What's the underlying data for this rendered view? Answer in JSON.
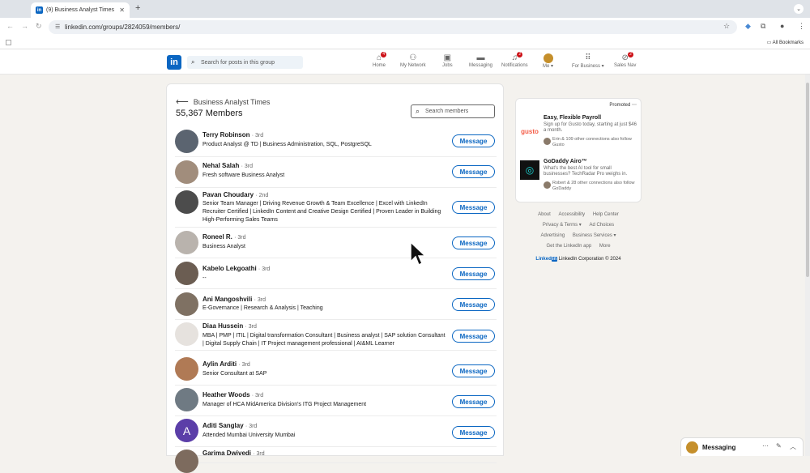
{
  "browser": {
    "tab_title": "(9) Business Analyst Times",
    "url": "linkedin.com/groups/2824059/members/",
    "all_bookmarks": "All Bookmarks"
  },
  "header": {
    "search_placeholder": "Search for posts in this group",
    "nav": [
      {
        "label": "Home",
        "icon": "home-icon",
        "badge": "4"
      },
      {
        "label": "My Network",
        "icon": "network-icon",
        "badge": ""
      },
      {
        "label": "Jobs",
        "icon": "briefcase-icon",
        "badge": ""
      },
      {
        "label": "Messaging",
        "icon": "chat-icon",
        "badge": ""
      },
      {
        "label": "Notifications",
        "icon": "bell-icon",
        "badge": "2"
      },
      {
        "label": "Me ▾",
        "icon": "avatar-icon",
        "badge": ""
      },
      {
        "label": "For Business ▾",
        "icon": "grid-icon",
        "badge": ""
      },
      {
        "label": "Sales Nav",
        "icon": "compass-icon",
        "badge": "2"
      }
    ]
  },
  "group": {
    "name": "Business Analyst Times",
    "member_count": "55,367 Members",
    "search_placeholder": "Search members"
  },
  "members": [
    {
      "name": "Terry Robinson",
      "degree": "· 3rd",
      "headline": "Product Analyst @ TD | Business Administration, SQL, PostgreSQL",
      "button": "Message",
      "avatar_color": "#5b6470"
    },
    {
      "name": "Nehal Salah",
      "degree": "· 3rd",
      "headline": "Fresh software Business Analyst",
      "button": "Message",
      "avatar_color": "#a18d7c"
    },
    {
      "name": "Pavan Choudary",
      "degree": "· 2nd",
      "headline": "Senior Team Manager | Driving Revenue Growth & Team Excellence | Excel with LinkedIn Recruiter Certified | LinkedIn Content and Creative Design Certified | Proven Leader in Building High-Performing Sales Teams",
      "button": "Message",
      "avatar_color": "#4c4c4c"
    },
    {
      "name": "Roneel R.",
      "degree": "· 3rd",
      "headline": "Business Analyst",
      "button": "Message",
      "avatar_color": "#b9b3ad"
    },
    {
      "name": "Kabelo Lekgoathi",
      "degree": "· 3rd",
      "headline": "--",
      "button": "Message",
      "avatar_color": "#6b5d52"
    },
    {
      "name": "Ani Mangoshvili",
      "degree": "· 3rd",
      "headline": "E-Governance | Research & Analysis | Teaching",
      "button": "Message",
      "avatar_color": "#7f7163"
    },
    {
      "name": "Diaa Hussein",
      "degree": "· 3rd",
      "headline": "MBA | PMP | ITIL | Digital transformation Consultant | Business analyst | SAP solution Consultant | Digital Supply Chain | IT Project management professional | AI&ML Learner",
      "button": "Message",
      "avatar_color": "#e6e2de"
    },
    {
      "name": "Aylin Arditi",
      "degree": "· 3rd",
      "headline": "Senior Consultant at SAP",
      "button": "Message",
      "avatar_color": "#b07a55"
    },
    {
      "name": "Heather Woods",
      "degree": "· 3rd",
      "headline": "Manager of HCA MidAmerica Division's ITG Project Management",
      "button": "Message",
      "avatar_color": "#6f7a83"
    },
    {
      "name": "Aditi Sanglay",
      "degree": "· 3rd",
      "headline": "Attended Mumbai University Mumbai",
      "button": "Message",
      "avatar_color": "#5b3ea8",
      "initial": "A"
    },
    {
      "name": "Garima Dwivedi",
      "degree": "· 3rd",
      "headline": "",
      "button": "",
      "avatar_color": "#7d6b5e"
    }
  ],
  "ads": {
    "promoted": "Promoted",
    "items": [
      {
        "logo": "gusto",
        "title": "Easy, Flexible Payroll",
        "body": "Sign up for Gusto today, starting at just $46 a month.",
        "social": "Erin & 109 other connections also follow Gusto"
      },
      {
        "logo": "",
        "title": "GoDaddy Airo™",
        "body": "What's the best AI tool for small businesses? TechRadar Pro weighs in.",
        "social": "Robert & 28 other connections also follow GoDaddy"
      }
    ]
  },
  "footer": {
    "row1": [
      "About",
      "Accessibility",
      "Help Center"
    ],
    "row2": [
      "Privacy & Terms ▾",
      "Ad Choices"
    ],
    "row3": [
      "Advertising",
      "Business Services ▾"
    ],
    "row4": [
      "Get the LinkedIn app",
      "More"
    ],
    "brand": "Linked",
    "brand_in": "in",
    "copyright": "LinkedIn Corporation © 2024"
  },
  "messaging": {
    "label": "Messaging"
  },
  "colors": {
    "accent": "#0a66c2",
    "badge": "#cc1016",
    "page_bg": "#f4f2ee"
  }
}
